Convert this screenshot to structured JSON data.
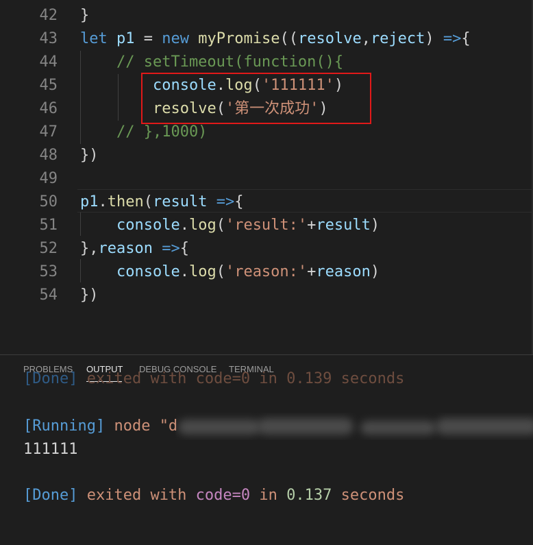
{
  "editor": {
    "lines": [
      {
        "num": "42",
        "tokens": [
          {
            "t": "}",
            "c": "ptn"
          }
        ]
      },
      {
        "num": "43",
        "tokens": [
          {
            "t": "let",
            "c": "kw"
          },
          {
            "t": " ",
            "c": "ptn"
          },
          {
            "t": "p1",
            "c": "var"
          },
          {
            "t": " = ",
            "c": "ptn"
          },
          {
            "t": "new",
            "c": "kw"
          },
          {
            "t": " ",
            "c": "ptn"
          },
          {
            "t": "myPromise",
            "c": "fn"
          },
          {
            "t": "((",
            "c": "ptn"
          },
          {
            "t": "resolve",
            "c": "var"
          },
          {
            "t": ",",
            "c": "ptn"
          },
          {
            "t": "reject",
            "c": "var"
          },
          {
            "t": ") ",
            "c": "ptn"
          },
          {
            "t": "=>",
            "c": "kw"
          },
          {
            "t": "{",
            "c": "ptn"
          }
        ]
      },
      {
        "num": "44",
        "tokens": [
          {
            "t": "    // setTimeout(function(){",
            "c": "cmt"
          }
        ]
      },
      {
        "num": "45",
        "tokens": [
          {
            "t": "        ",
            "c": "ptn"
          },
          {
            "t": "console",
            "c": "var"
          },
          {
            "t": ".",
            "c": "ptn"
          },
          {
            "t": "log",
            "c": "fn"
          },
          {
            "t": "(",
            "c": "ptn"
          },
          {
            "t": "'111111'",
            "c": "str"
          },
          {
            "t": ")",
            "c": "ptn"
          }
        ]
      },
      {
        "num": "46",
        "tokens": [
          {
            "t": "        ",
            "c": "ptn"
          },
          {
            "t": "resolve",
            "c": "fn"
          },
          {
            "t": "(",
            "c": "ptn"
          },
          {
            "t": "'第一次成功'",
            "c": "str"
          },
          {
            "t": ")",
            "c": "ptn"
          }
        ]
      },
      {
        "num": "47",
        "tokens": [
          {
            "t": "    // },1000)",
            "c": "cmt"
          }
        ]
      },
      {
        "num": "48",
        "tokens": [
          {
            "t": "})",
            "c": "ptn"
          }
        ]
      },
      {
        "num": "49",
        "tokens": []
      },
      {
        "num": "50",
        "tokens": [
          {
            "t": "p1",
            "c": "var"
          },
          {
            "t": ".",
            "c": "ptn"
          },
          {
            "t": "then",
            "c": "fn"
          },
          {
            "t": "(",
            "c": "ptn"
          },
          {
            "t": "result",
            "c": "var"
          },
          {
            "t": " ",
            "c": "ptn"
          },
          {
            "t": "=>",
            "c": "kw"
          },
          {
            "t": "{",
            "c": "ptn"
          }
        ]
      },
      {
        "num": "51",
        "tokens": [
          {
            "t": "    ",
            "c": "ptn"
          },
          {
            "t": "console",
            "c": "var"
          },
          {
            "t": ".",
            "c": "ptn"
          },
          {
            "t": "log",
            "c": "fn"
          },
          {
            "t": "(",
            "c": "ptn"
          },
          {
            "t": "'result:'",
            "c": "str"
          },
          {
            "t": "+",
            "c": "ptn"
          },
          {
            "t": "result",
            "c": "var"
          },
          {
            "t": ")",
            "c": "ptn"
          }
        ]
      },
      {
        "num": "52",
        "tokens": [
          {
            "t": "},",
            "c": "ptn"
          },
          {
            "t": "reason",
            "c": "var"
          },
          {
            "t": " ",
            "c": "ptn"
          },
          {
            "t": "=>",
            "c": "kw"
          },
          {
            "t": "{",
            "c": "ptn"
          }
        ]
      },
      {
        "num": "53",
        "tokens": [
          {
            "t": "    ",
            "c": "ptn"
          },
          {
            "t": "console",
            "c": "var"
          },
          {
            "t": ".",
            "c": "ptn"
          },
          {
            "t": "log",
            "c": "fn"
          },
          {
            "t": "(",
            "c": "ptn"
          },
          {
            "t": "'reason:'",
            "c": "str"
          },
          {
            "t": "+",
            "c": "ptn"
          },
          {
            "t": "reason",
            "c": "var"
          },
          {
            "t": ")",
            "c": "ptn"
          }
        ]
      },
      {
        "num": "54",
        "tokens": [
          {
            "t": "})",
            "c": "ptn"
          }
        ]
      }
    ]
  },
  "panel": {
    "tabs": {
      "problems": "PROBLEMS",
      "output": "OUTPUT",
      "debug_console": "DEBUG CONSOLE",
      "terminal": "TERMINAL"
    },
    "cut_line": {
      "a": "[Done]",
      "b": " exited with code=0 in 0.139 seconds"
    },
    "running_line": {
      "tag": "[Running]",
      "cmd": " node \"d"
    },
    "output_value": "111111",
    "done_line": {
      "tag": "[Done]",
      "exited": " exited with ",
      "code": "code=0",
      "in": " in ",
      "time": "0.137",
      "seconds": " seconds"
    }
  }
}
